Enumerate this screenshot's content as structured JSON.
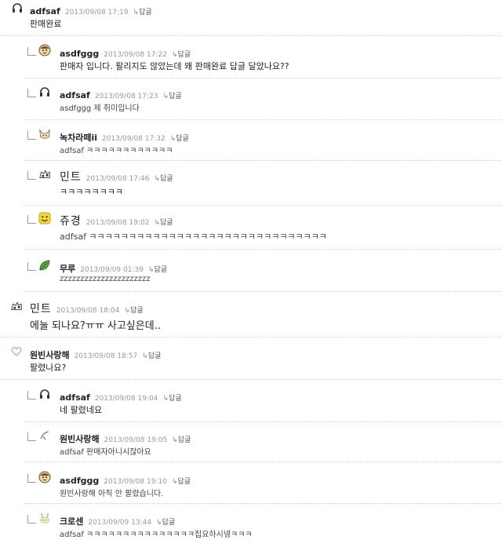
{
  "reply_label": "답글",
  "comments": [
    {
      "nick": "adfsaf",
      "date": "2013/09/08 17:19",
      "body": "판매완료",
      "icon": "headphones-icon"
    },
    {
      "nick": "asdfggg",
      "date": "2013/09/08 17:22",
      "body": "판매자 입니다. 팔리지도 않았는데 왜 판매완료 답글 달았나요??",
      "icon": "face-avatar-icon"
    },
    {
      "nick": "adfsaf",
      "date": "2013/09/08 17:23",
      "body": "asdfggg 제 취미입니다",
      "icon": "headphones-icon"
    },
    {
      "nick": "녹차라떼ii",
      "date": "2013/09/08 17:32",
      "body": "adfsaf ㅋㅋㅋㅋㅋㅋㅋㅋㅋㅋㅋㅋ",
      "icon": "fox-icon"
    },
    {
      "nick": "민트",
      "date": "2013/09/08 17:46",
      "body": "ㅋㅋㅋㅋㅋㅋㅋㅋ",
      "icon": "cow-icon"
    },
    {
      "nick": "쥬경",
      "date": "2013/09/08 19:02",
      "body": "adfsaf ㅋㅋㅋㅋㅋㅋㅋㅋㅋㅋㅋㅋㅋㅋㅋㅋㅋㅋㅋㅋㅋㅋㅋㅋㅋㅋㅋㅋㅋㅋ",
      "icon": "smiley-icon"
    },
    {
      "nick": "무루",
      "date": "2013/09/09 01:39",
      "body": "zzzzzzzzzzzzzzzzzzzzzz",
      "icon": "leaf-icon"
    },
    {
      "nick": "민트",
      "date": "2013/09/08 18:04",
      "body": "에눌 되나요?ㅠㅠ 사고싶은데..",
      "icon": "cow-icon"
    },
    {
      "nick": "원빈사랑해",
      "date": "2013/09/08 18:57",
      "body": "팔렸나요?",
      "icon": "heart-icon"
    },
    {
      "nick": "adfsaf",
      "date": "2013/09/08 19:04",
      "body": "네 팔렸네요",
      "icon": "headphones-icon"
    },
    {
      "nick": "원빈사랑해",
      "date": "2013/09/08 19:05",
      "body": "adfsaf 판매자아니시잖아요",
      "icon": "bird-icon"
    },
    {
      "nick": "asdfggg",
      "date": "2013/09/08 19:10",
      "body": "원빈사랑해 아직 안 팔렸습니다.",
      "icon": "face-avatar-icon"
    },
    {
      "nick": "크로센",
      "date": "2013/09/09 13:44",
      "body": "adfsaf ㅋㅋㅋㅋㅋㅋㅋㅋㅋㅋㅋㅋㅋㅋㅋ집요하시넹ㅋㅋㅋ",
      "icon": "rabbit-icon"
    }
  ]
}
